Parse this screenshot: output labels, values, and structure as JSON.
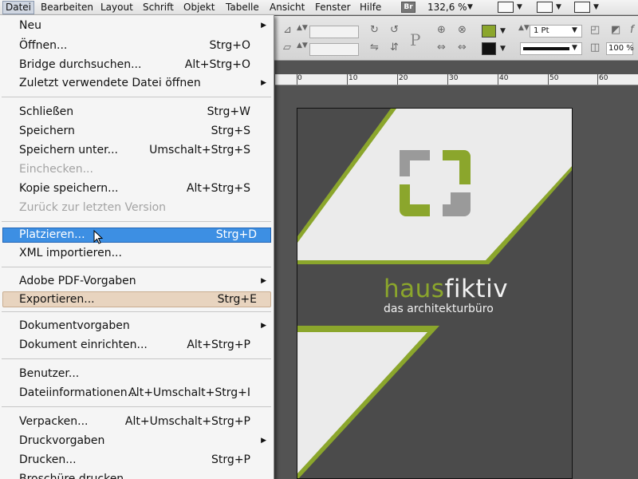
{
  "menubar": {
    "items": [
      "Datei",
      "Bearbeiten",
      "Layout",
      "Schrift",
      "Objekt",
      "Tabelle",
      "Ansicht",
      "Fenster",
      "Hilfe"
    ],
    "bridge_badge": "Br",
    "zoom": "132,6 %"
  },
  "controlbar": {
    "stroke_weight": "1 Pt",
    "opacity": "100 %",
    "fill_color": "#8ba62c",
    "stroke_color": "#111111"
  },
  "ruler": {
    "labels": [
      "0",
      "10",
      "20",
      "30",
      "40",
      "50",
      "60"
    ]
  },
  "document": {
    "brand_part1": "haus",
    "brand_part2": "fiktiv",
    "tagline": "das architekturbüro",
    "accent_color": "#8ba62c",
    "dark_color": "#4b4b4b",
    "light_color": "#ebebeb"
  },
  "dropdown": {
    "items": [
      {
        "label": "Neu",
        "shortcut": "",
        "submenu": true
      },
      {
        "label": "Öffnen...",
        "shortcut": "Strg+O"
      },
      {
        "label": "Bridge durchsuchen...",
        "shortcut": "Alt+Strg+O"
      },
      {
        "label": "Zuletzt verwendete Datei öffnen",
        "shortcut": "",
        "submenu": true
      },
      {
        "label": "Schließen",
        "shortcut": "Strg+W"
      },
      {
        "label": "Speichern",
        "shortcut": "Strg+S"
      },
      {
        "label": "Speichern unter...",
        "shortcut": "Umschalt+Strg+S"
      },
      {
        "label": "Einchecken...",
        "shortcut": "",
        "disabled": true
      },
      {
        "label": "Kopie speichern...",
        "shortcut": "Alt+Strg+S"
      },
      {
        "label": "Zurück zur letzten Version",
        "shortcut": "",
        "disabled": true
      },
      {
        "label": "Platzieren...",
        "shortcut": "Strg+D",
        "state": "highlighted"
      },
      {
        "label": "XML importieren...",
        "shortcut": ""
      },
      {
        "label": "Adobe PDF-Vorgaben",
        "shortcut": "",
        "submenu": true
      },
      {
        "label": "Exportieren...",
        "shortcut": "Strg+E",
        "state": "hovered"
      },
      {
        "label": "Dokumentvorgaben",
        "shortcut": "",
        "submenu": true
      },
      {
        "label": "Dokument einrichten...",
        "shortcut": "Alt+Strg+P"
      },
      {
        "label": "Benutzer...",
        "shortcut": ""
      },
      {
        "label": "Dateiinformationen...",
        "shortcut": "Alt+Umschalt+Strg+I"
      },
      {
        "label": "Verpacken...",
        "shortcut": "Alt+Umschalt+Strg+P"
      },
      {
        "label": "Druckvorgaben",
        "shortcut": "",
        "submenu": true
      },
      {
        "label": "Drucken...",
        "shortcut": "Strg+P"
      },
      {
        "label": "Broschüre drucken...",
        "shortcut": ""
      }
    ]
  }
}
